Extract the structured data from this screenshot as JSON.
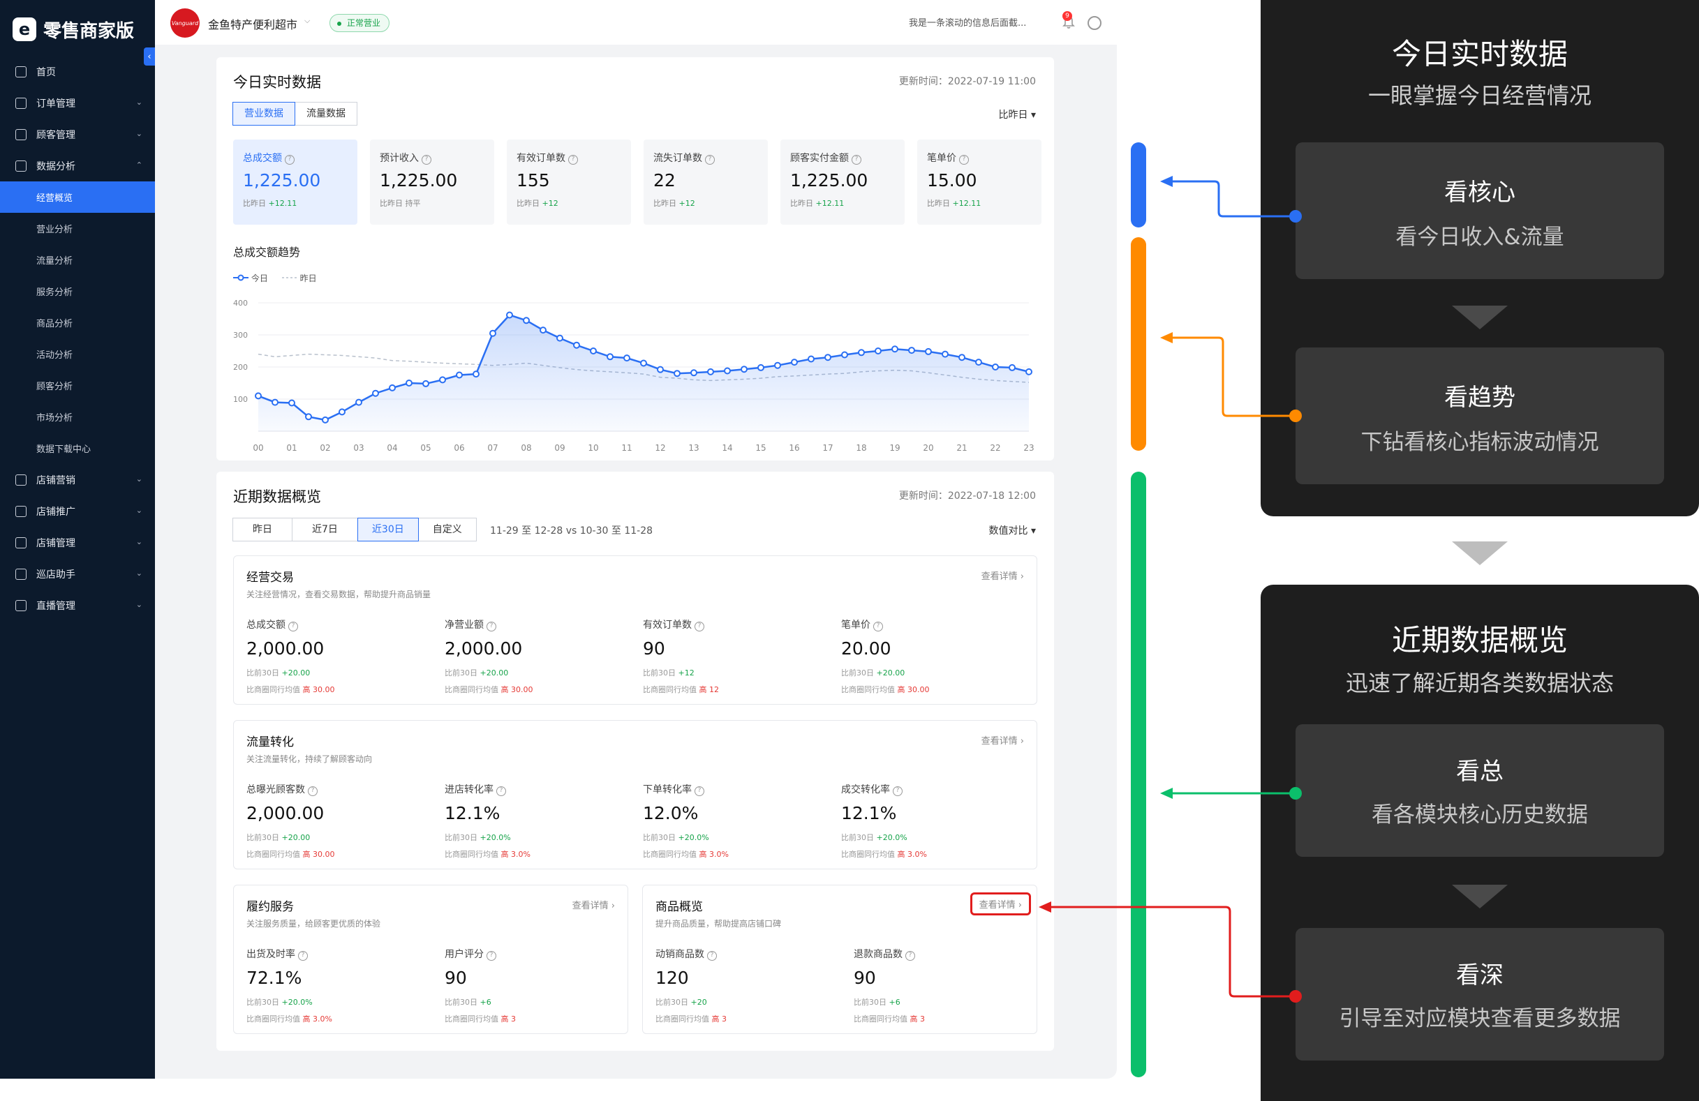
{
  "brand": {
    "name": "零售商家版",
    "logo_letter": "e"
  },
  "sidebar": {
    "items": [
      {
        "label": "首页",
        "icon": "home-icon",
        "type": "item"
      },
      {
        "label": "订单管理",
        "icon": "order-icon",
        "type": "group"
      },
      {
        "label": "顾客管理",
        "icon": "customer-icon",
        "type": "group"
      },
      {
        "label": "数据分析",
        "icon": "analytics-icon",
        "type": "group-open"
      },
      {
        "label": "经营概览",
        "type": "sub",
        "active": true
      },
      {
        "label": "营业分析",
        "type": "sub"
      },
      {
        "label": "流量分析",
        "type": "sub"
      },
      {
        "label": "服务分析",
        "type": "sub"
      },
      {
        "label": "商品分析",
        "type": "sub"
      },
      {
        "label": "活动分析",
        "type": "sub"
      },
      {
        "label": "顾客分析",
        "type": "sub"
      },
      {
        "label": "市场分析",
        "type": "sub"
      },
      {
        "label": "数据下载中心",
        "type": "sub"
      },
      {
        "label": "店铺营销",
        "icon": "marketing-icon",
        "type": "group"
      },
      {
        "label": "店铺推广",
        "icon": "promotion-icon",
        "type": "group"
      },
      {
        "label": "店铺管理",
        "icon": "store-settings-icon",
        "type": "group"
      },
      {
        "label": "巡店助手",
        "icon": "patrol-icon",
        "type": "group"
      },
      {
        "label": "直播管理",
        "icon": "live-icon",
        "type": "group"
      }
    ]
  },
  "topbar": {
    "store_logo_text": "Vanguard",
    "store_name": "金鱼特产便利超市",
    "status": "正常营业",
    "marquee": "我是一条滚动的信息后面截...",
    "notification_count": "9"
  },
  "realtime": {
    "title": "今日实时数据",
    "updated": "更新时间：2022-07-19 11:00",
    "tabs": [
      "营业数据",
      "流量数据"
    ],
    "compare": "比昨日",
    "metrics": [
      {
        "label": "总成交额",
        "value": "1,225.00",
        "cmp_prefix": "比昨日",
        "cmp": "+12.11",
        "trend": "up"
      },
      {
        "label": "预计收入",
        "value": "1,225.00",
        "cmp_prefix": "比昨日",
        "cmp": "持平",
        "trend": "flat"
      },
      {
        "label": "有效订单数",
        "value": "155",
        "cmp_prefix": "比昨日",
        "cmp": "+12",
        "trend": "up"
      },
      {
        "label": "流失订单数",
        "value": "22",
        "cmp_prefix": "比昨日",
        "cmp": "+12",
        "trend": "up"
      },
      {
        "label": "顾客实付金额",
        "value": "1,225.00",
        "cmp_prefix": "比昨日",
        "cmp": "+12.11",
        "trend": "up"
      },
      {
        "label": "笔单价",
        "value": "15.00",
        "cmp_prefix": "比昨日",
        "cmp": "+12.11",
        "trend": "up"
      }
    ],
    "trend_title": "总成交额趋势",
    "legend_today": "今日",
    "legend_yesterday": "昨日"
  },
  "chart_data": {
    "type": "line",
    "x": [
      "00",
      "01",
      "02",
      "03",
      "04",
      "05",
      "06",
      "07",
      "08",
      "09",
      "10",
      "11",
      "12",
      "13",
      "14",
      "15",
      "16",
      "17",
      "18",
      "19",
      "20",
      "21",
      "22",
      "23"
    ],
    "x_points": [
      0,
      0.5,
      1,
      1.5,
      2,
      2.5,
      3,
      3.5,
      4,
      4.5,
      5,
      5.5,
      6,
      6.5,
      7,
      7.5,
      8,
      8.5,
      9,
      9.5,
      10,
      10.5,
      11,
      11.5,
      12,
      12.5,
      13,
      13.5,
      14,
      14.5,
      15,
      15.5,
      16,
      16.5,
      17,
      17.5,
      18,
      18.5,
      19,
      19.5,
      20,
      20.5,
      21,
      21.5,
      22,
      22.5,
      23
    ],
    "ylim": [
      0,
      400
    ],
    "yticks": [
      100,
      200,
      300,
      400
    ],
    "series": [
      {
        "name": "今日",
        "color": "#2a6ff3",
        "style": "solid",
        "values": [
          110,
          90,
          88,
          45,
          35,
          60,
          90,
          118,
          135,
          150,
          148,
          160,
          175,
          178,
          305,
          362,
          345,
          315,
          290,
          268,
          250,
          232,
          228,
          212,
          192,
          180,
          182,
          185,
          188,
          193,
          198,
          205,
          215,
          225,
          230,
          238,
          245,
          250,
          256,
          252,
          248,
          240,
          230,
          215,
          200,
          198,
          185
        ]
      },
      {
        "name": "昨日",
        "color": "#b8c0cc",
        "style": "dashed",
        "values": [
          240,
          232,
          236,
          240,
          238,
          236,
          232,
          228,
          220,
          218,
          215,
          212,
          210,
          208,
          205,
          208,
          212,
          205,
          198,
          192,
          188,
          185,
          182,
          178,
          168,
          165,
          160,
          158,
          160,
          162,
          165,
          170,
          172,
          175,
          178,
          180,
          185,
          188,
          190,
          188,
          182,
          175,
          168,
          162,
          158,
          155,
          152
        ]
      }
    ]
  },
  "recent": {
    "title": "近期数据概览",
    "updated": "更新时间：2022-07-18 12:00",
    "ranges": [
      "昨日",
      "近7日",
      "近30日",
      "自定义"
    ],
    "active_range": 2,
    "range_text": "11-29 至 12-28  vs  10-30 至 11-28",
    "value_select": "数值对比",
    "panels": {
      "trade": {
        "title": "经营交易",
        "desc": "关注经营情况，查看交易数据，帮助提升商品销量",
        "link": "查看详情",
        "metrics": [
          {
            "label": "总成交额",
            "value": "2,000.00",
            "p1": "比前30日",
            "v1": "+20.00",
            "p2": "比商圈同行均值",
            "v2": "高 30.00"
          },
          {
            "label": "净营业额",
            "value": "2,000.00",
            "p1": "比前30日",
            "v1": "+20.00",
            "p2": "比商圈同行均值",
            "v2": "高 30.00"
          },
          {
            "label": "有效订单数",
            "value": "90",
            "p1": "比前30日",
            "v1": "+12",
            "p2": "比商圈同行均值",
            "v2": "高 12"
          },
          {
            "label": "笔单价",
            "value": "20.00",
            "p1": "比前30日",
            "v1": "+20.00",
            "p2": "比商圈同行均值",
            "v2": "高 30.00"
          }
        ]
      },
      "traffic": {
        "title": "流量转化",
        "desc": "关注流量转化，持续了解顾客动向",
        "link": "查看详情",
        "metrics": [
          {
            "label": "总曝光顾客数",
            "value": "2,000.00",
            "p1": "比前30日",
            "v1": "+20.00",
            "p2": "比商圈同行均值",
            "v2": "高 30.00"
          },
          {
            "label": "进店转化率",
            "value": "12.1%",
            "p1": "比前30日",
            "v1": "+20.0%",
            "p2": "比商圈同行均值",
            "v2": "高 3.0%"
          },
          {
            "label": "下单转化率",
            "value": "12.0%",
            "p1": "比前30日",
            "v1": "+20.0%",
            "p2": "比商圈同行均值",
            "v2": "高 3.0%"
          },
          {
            "label": "成交转化率",
            "value": "12.1%",
            "p1": "比前30日",
            "v1": "+20.0%",
            "p2": "比商圈同行均值",
            "v2": "高 3.0%"
          }
        ]
      },
      "service": {
        "title": "履约服务",
        "desc": "关注服务质量，给顾客更优质的体验",
        "link": "查看详情",
        "metrics": [
          {
            "label": "出货及时率",
            "value": "72.1%",
            "p1": "比前30日",
            "v1": "+20.0%",
            "p2": "比商圈同行均值",
            "v2": "高 3.0%"
          },
          {
            "label": "用户评分",
            "value": "90",
            "p1": "比前30日",
            "v1": "+6",
            "p2": "比商圈同行均值",
            "v2": "高 3"
          }
        ]
      },
      "goods": {
        "title": "商品概览",
        "desc": "提升商品质量，帮助提高店铺口碑",
        "link": "查看详情",
        "metrics": [
          {
            "label": "动销商品数",
            "value": "120",
            "p1": "比前30日",
            "v1": "+20",
            "p2": "比商圈同行均值",
            "v2": "高 3"
          },
          {
            "label": "退款商品数",
            "value": "90",
            "p1": "比前30日",
            "v1": "+6",
            "p2": "比商圈同行均值",
            "v2": "高 3"
          }
        ]
      }
    }
  },
  "explain": {
    "colors": {
      "blue": "#2a6ff3",
      "orange": "#ff8a00",
      "green": "#0bbf6b",
      "red": "#e11d1d"
    },
    "section1": {
      "title": "今日实时数据",
      "subtitle": "一眼掌握今日经营情况",
      "box1": {
        "title": "看核心",
        "sub": "看今日收入&流量"
      },
      "box2": {
        "title": "看趋势",
        "sub": "下钻看核心指标波动情况"
      }
    },
    "section2": {
      "title": "近期数据概览",
      "subtitle": "迅速了解近期各类数据状态",
      "box1": {
        "title": "看总",
        "sub": "看各模块核心历史数据"
      },
      "box2": {
        "title": "看深",
        "sub": "引导至对应模块查看更多数据"
      }
    }
  }
}
